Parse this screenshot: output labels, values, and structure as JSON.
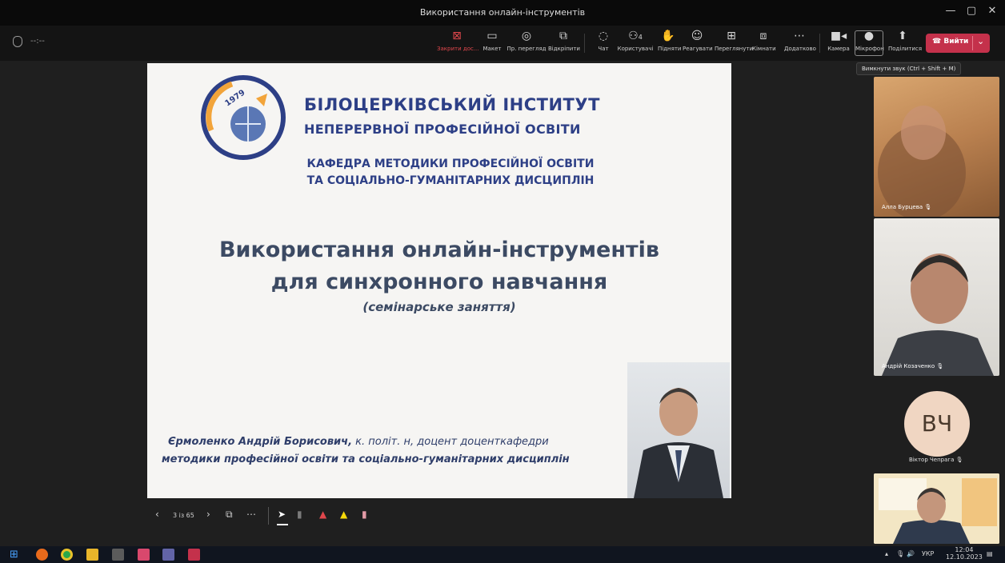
{
  "window": {
    "title": "Використання онлайн-інструментів",
    "minimize_icon": "minimize-icon",
    "restore_icon": "restore-icon",
    "close_icon": "close-icon"
  },
  "toolbar": {
    "timer": "--:--",
    "buttons": [
      {
        "label": "Закрити дос...",
        "icon": "close-share-icon"
      },
      {
        "label": "Макет",
        "icon": "layout-icon"
      },
      {
        "label": "Пр. перегляд",
        "icon": "preview-icon"
      },
      {
        "label": "Відкріпити",
        "icon": "pop-out-icon"
      },
      {
        "label": "Чат",
        "icon": "chat-icon"
      },
      {
        "label": "Користувачі",
        "icon": "people-icon",
        "count": "4"
      },
      {
        "label": "Підняти",
        "icon": "raise-hand-icon"
      },
      {
        "label": "Реагувати",
        "icon": "react-icon"
      },
      {
        "label": "Переглянути",
        "icon": "view-icon"
      },
      {
        "label": "Кімнати",
        "icon": "rooms-icon"
      },
      {
        "label": "Додатково",
        "icon": "more-icon"
      },
      {
        "label": "Камера",
        "icon": "camera-icon"
      },
      {
        "label": "Мікрофон",
        "icon": "mic-icon"
      },
      {
        "label": "Поділитися",
        "icon": "share-icon"
      }
    ],
    "leave_label": "Вийти",
    "mic_tooltip": "Вимкнути звук (Ctrl + Shift + M)",
    "accent_color": "#c4314b"
  },
  "slide": {
    "institute_line1": "БІЛОЦЕРКІВСЬКИЙ ІНСТИТУТ",
    "institute_line2": "НЕПЕРЕРВНОЇ ПРОФЕСІЙНОЇ ОСВІТИ",
    "logo_year": "1979",
    "dept_line1": "КАФЕДРА МЕТОДИКИ ПРОФЕСІЙНОЇ ОСВІТИ",
    "dept_line2": "ТА СОЦІАЛЬНО-ГУМАНІТАРНИХ ДИСЦИПЛІН",
    "title_line1": "Використання онлайн-інструментів",
    "title_line2": "для синхронного навчання",
    "subtitle": "(семінарське заняття)",
    "author_name": "Єрмоленко Андрій Борисович,",
    "author_line1_rest": " к. політ. н, доцент доценткафедри",
    "author_line2": "методики професійної освіти та соціально-гуманітарних дисциплін"
  },
  "slide_controls": {
    "page": "3 із 65"
  },
  "participants": [
    {
      "name": "Алла Бурцева"
    },
    {
      "name": "Андрій Козаченко"
    },
    {
      "name": "Віктор Чепрага",
      "initials": "ВЧ"
    }
  ],
  "taskbar": {
    "language": "УКР",
    "time": "12:04",
    "date": "12.10.2023"
  }
}
